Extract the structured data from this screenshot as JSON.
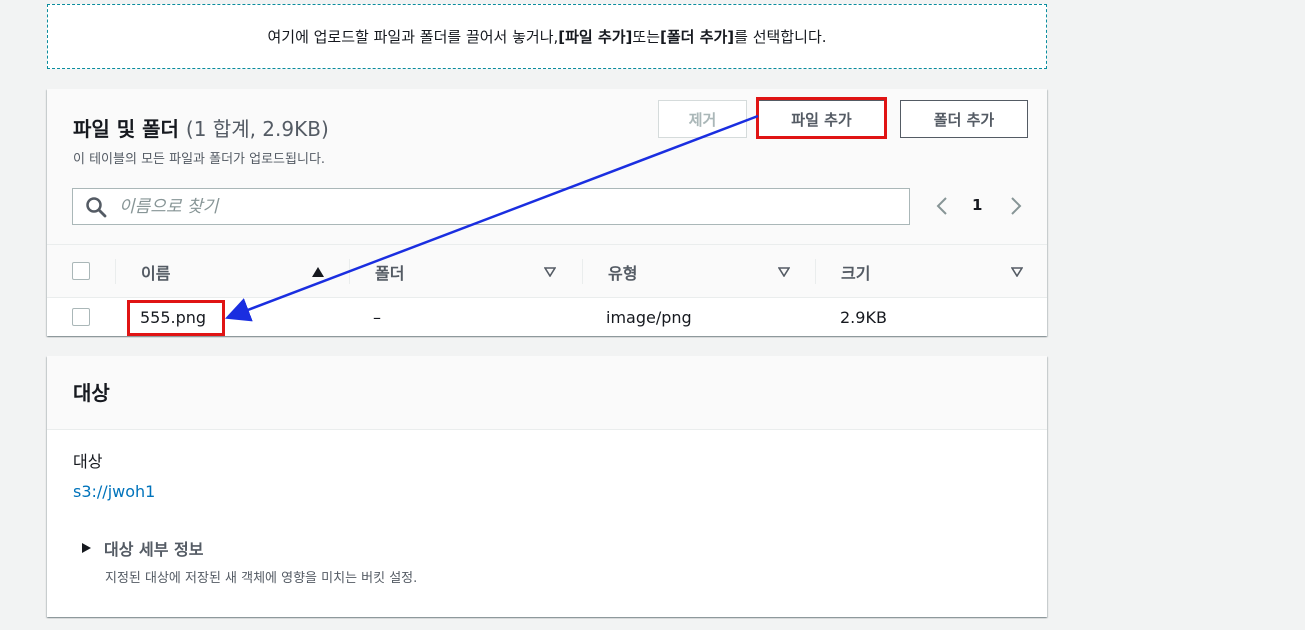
{
  "dropzone": {
    "text_prefix": "여기에 업로드할 파일과 폴더를 끌어서 놓거나, ",
    "bold_add_files": "[파일 추가]",
    "text_or": " 또는 ",
    "bold_add_folder": "[폴더 추가]",
    "text_suffix": "를 선택합니다."
  },
  "files_panel": {
    "title": "파일 및 폴더",
    "count": "(1 합계, 2.9KB)",
    "description": "이 테이블의 모든 파일과 폴더가 업로드됩니다.",
    "remove_label": "제거",
    "add_files_label": "파일 추가",
    "add_folder_label": "폴더 추가",
    "search_placeholder": "이름으로 찾기",
    "page_number": "1",
    "columns": [
      "이름",
      "폴더",
      "유형",
      "크기"
    ],
    "rows": [
      {
        "name": "555.png",
        "folder": "–",
        "type": "image/png",
        "size": "2.9KB"
      }
    ]
  },
  "destination_panel": {
    "title": "대상",
    "label": "대상",
    "link": "s3://jwoh1",
    "details_title": "대상 세부 정보",
    "details_desc": "지정된 대상에 저장된 새 객체에 영향을 미치는 버킷 설정."
  },
  "colors": {
    "highlight": "#e01414",
    "arrow": "#1a2ee0",
    "link": "#0073bb",
    "dropzone_border": "#0a8d9e"
  }
}
